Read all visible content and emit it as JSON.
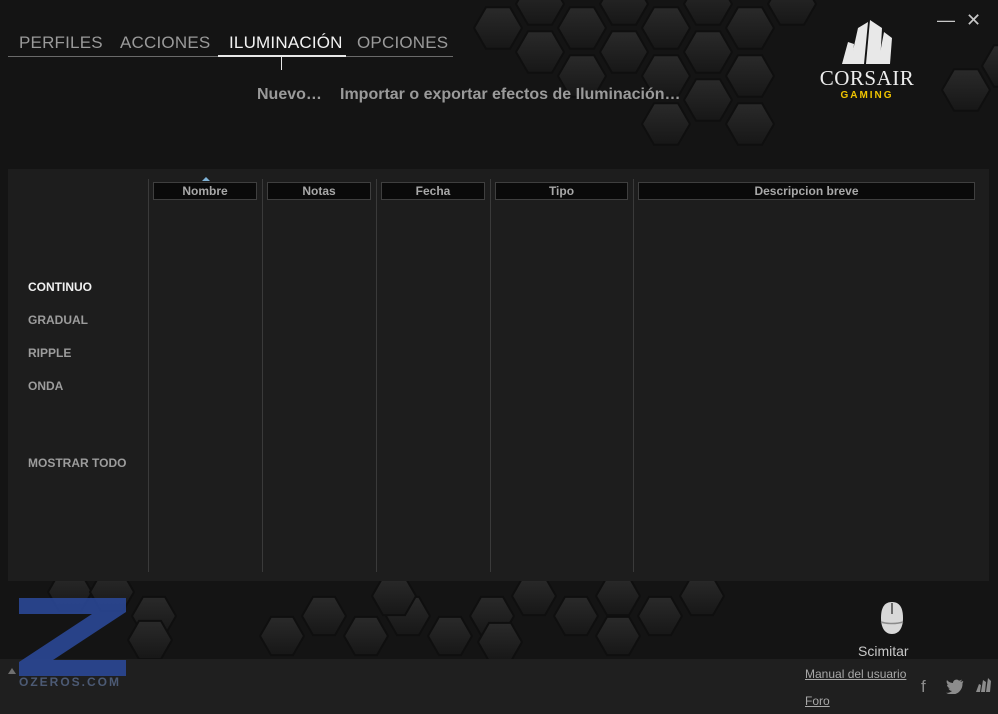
{
  "nav": {
    "tabs": [
      {
        "label": "PERFILES"
      },
      {
        "label": "ACCIONES"
      },
      {
        "label": "ILUMINACIÓN"
      },
      {
        "label": "OPCIONES"
      }
    ],
    "active_tab": "ILUMINACIÓN"
  },
  "sub_actions": {
    "new": "Nuevo…",
    "import_export": "Importar o exportar efectos de Iluminación…"
  },
  "window_controls": {
    "minimize": "—",
    "close": "✕"
  },
  "brand": {
    "name": "CORSAIR",
    "sub": "GAMING",
    "accent_color": "#f0c400"
  },
  "categories": [
    {
      "label": "CONTINUO",
      "active": true
    },
    {
      "label": "GRADUAL",
      "active": false
    },
    {
      "label": "RIPPLE",
      "active": false
    },
    {
      "label": "ONDA",
      "active": false
    },
    {
      "label": "MOSTRAR TODO",
      "active": false
    }
  ],
  "table": {
    "columns": [
      "Nombre",
      "Notas",
      "Fecha",
      "Tipo",
      "Descripcion breve"
    ],
    "sorted_by": "Nombre",
    "rows": []
  },
  "device": {
    "name": "Scimitar",
    "icon": "mouse-icon"
  },
  "footer": {
    "manual": "Manual del usuario",
    "forum": "Foro",
    "social": [
      "facebook-icon",
      "twitter-icon",
      "corsair-icon"
    ]
  },
  "watermark": {
    "text": "OZEROS.COM",
    "color": "#2b4a9c"
  }
}
